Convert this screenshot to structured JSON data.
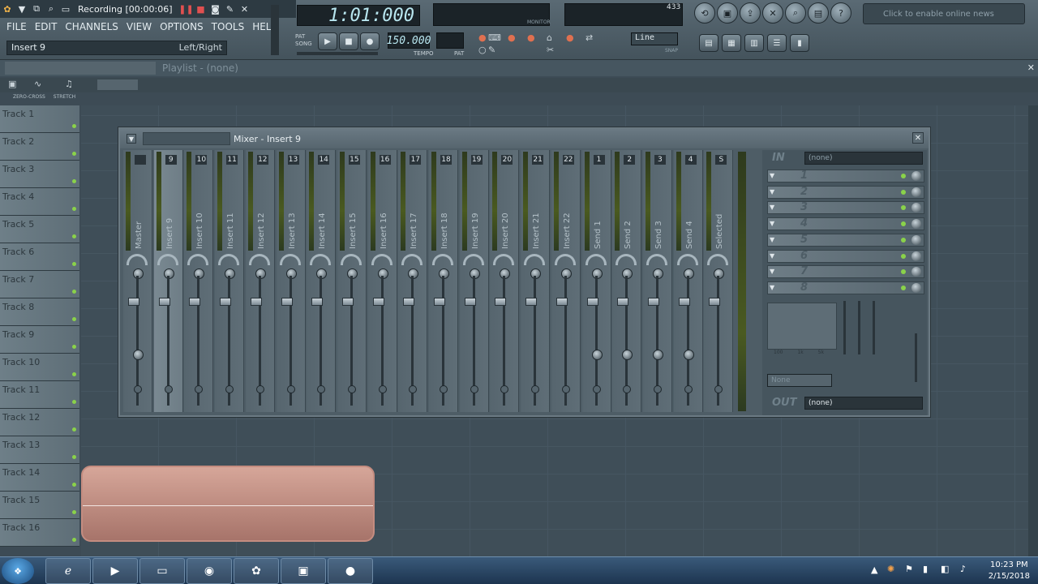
{
  "title": {
    "recording": "Recording [00:00:06]"
  },
  "menu": [
    "FILE",
    "EDIT",
    "CHANNELS",
    "VIEW",
    "OPTIONS",
    "TOOLS",
    "HELP"
  ],
  "hint": {
    "left": "Insert 9",
    "right": "Left/Right"
  },
  "transport": {
    "time": "1:01:000",
    "tempo": "150.000",
    "pat": "PAT",
    "song": "SONG",
    "snap": "Line",
    "labels": {
      "tempo": "TEMPO",
      "pat": "PAT",
      "monitor": "MONITOR",
      "snap": "SNAP"
    }
  },
  "cpu": {
    "value": "433"
  },
  "news": "Click to enable online news",
  "playlist": {
    "title": "Playlist - (none)"
  },
  "toolbar": {
    "zero_cross": "ZERO-CROSS",
    "stretch": "STRETCH"
  },
  "tracks": [
    "Track 1",
    "Track 2",
    "Track 3",
    "Track 4",
    "Track 5",
    "Track 6",
    "Track 7",
    "Track 8",
    "Track 9",
    "Track 10",
    "Track 11",
    "Track 12",
    "Track 13",
    "Track 14",
    "Track 15",
    "Track 16"
  ],
  "mixer": {
    "title": "Mixer - Insert 9",
    "strips": [
      {
        "name": "Master",
        "num": ""
      },
      {
        "name": "Insert 9",
        "num": "9"
      },
      {
        "name": "Insert 10",
        "num": "10"
      },
      {
        "name": "Insert 11",
        "num": "11"
      },
      {
        "name": "Insert 12",
        "num": "12"
      },
      {
        "name": "Insert 13",
        "num": "13"
      },
      {
        "name": "Insert 14",
        "num": "14"
      },
      {
        "name": "Insert 15",
        "num": "15"
      },
      {
        "name": "Insert 16",
        "num": "16"
      },
      {
        "name": "Insert 17",
        "num": "17"
      },
      {
        "name": "Insert 18",
        "num": "18"
      },
      {
        "name": "Insert 19",
        "num": "19"
      },
      {
        "name": "Insert 20",
        "num": "20"
      },
      {
        "name": "Insert 21",
        "num": "21"
      },
      {
        "name": "Insert 22",
        "num": "22"
      },
      {
        "name": "Send 1",
        "num": "1"
      },
      {
        "name": "Send 2",
        "num": "2"
      },
      {
        "name": "Send 3",
        "num": "3"
      },
      {
        "name": "Send 4",
        "num": "4"
      },
      {
        "name": "Selected",
        "num": "S"
      }
    ],
    "in_label": "IN",
    "in_value": "(none)",
    "out_label": "OUT",
    "out_value": "(none)",
    "slots": [
      "1",
      "2",
      "3",
      "4",
      "5",
      "6",
      "7",
      "8"
    ],
    "eq_label": "None",
    "eq_freqs": [
      "100",
      "1k",
      "5k"
    ]
  },
  "clock": {
    "time": "10:23 PM",
    "date": "2/15/2018"
  }
}
